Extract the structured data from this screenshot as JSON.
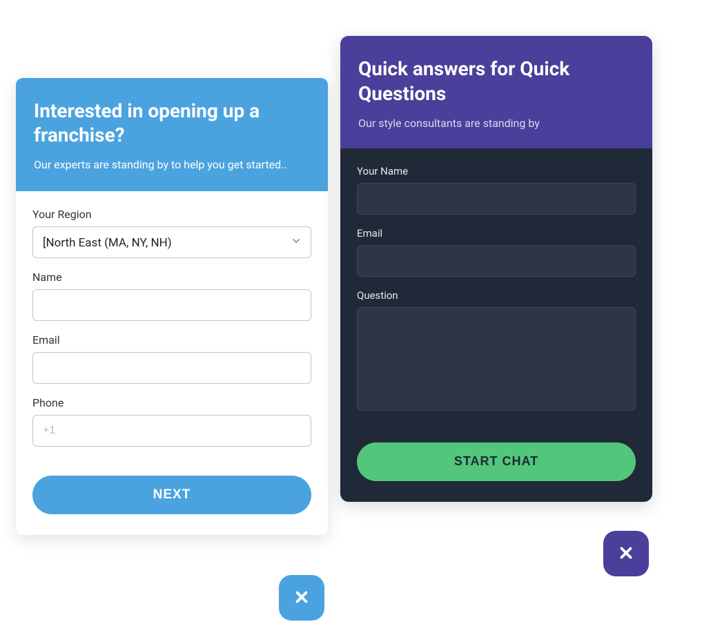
{
  "franchise_card": {
    "title": "Interested in opening up a franchise?",
    "subtitle": "Our experts are standing by to help you get started..",
    "fields": {
      "region": {
        "label": "Your Region",
        "value": "[North East (MA, NY, NH)"
      },
      "name": {
        "label": "Name",
        "value": ""
      },
      "email": {
        "label": "Email",
        "value": ""
      },
      "phone": {
        "label": "Phone",
        "value": "",
        "placeholder": "+1"
      }
    },
    "button_label": "NEXT"
  },
  "chat_card": {
    "title": "Quick answers for Quick Questions",
    "subtitle": "Our style consultants are standing by",
    "fields": {
      "name": {
        "label": "Your Name",
        "value": ""
      },
      "email": {
        "label": "Email",
        "value": ""
      },
      "question": {
        "label": "Question",
        "value": ""
      }
    },
    "button_label": "START CHAT"
  },
  "colors": {
    "blue_accent": "#4aa3df",
    "purple_accent": "#4a3f9a",
    "green_accent": "#52c67a",
    "dark_bg": "#1f2937"
  }
}
